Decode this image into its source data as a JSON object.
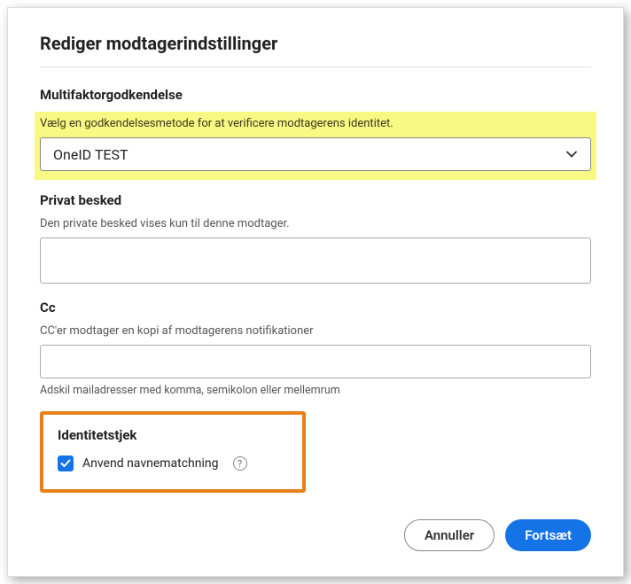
{
  "dialog": {
    "title": "Rediger modtagerindstillinger"
  },
  "mfa": {
    "heading": "Multifaktorgodkendelse",
    "helper": "Vælg en godkendelsesmetode for at verificere modtagerens identitet.",
    "selected": "OneID TEST"
  },
  "privateMsg": {
    "heading": "Privat besked",
    "helper": "Den private besked vises kun til denne modtager.",
    "value": ""
  },
  "cc": {
    "heading": "Cc",
    "helper": "CC'er modtager en kopi af modtagerens notifikationer",
    "value": "",
    "hint": "Adskil mailadresser med komma, semikolon eller mellemrum"
  },
  "identity": {
    "heading": "Identitetstjek",
    "checkbox_label": "Anvend navnematchning",
    "checked": true
  },
  "buttons": {
    "cancel": "Annuller",
    "continue": "Fortsæt"
  }
}
